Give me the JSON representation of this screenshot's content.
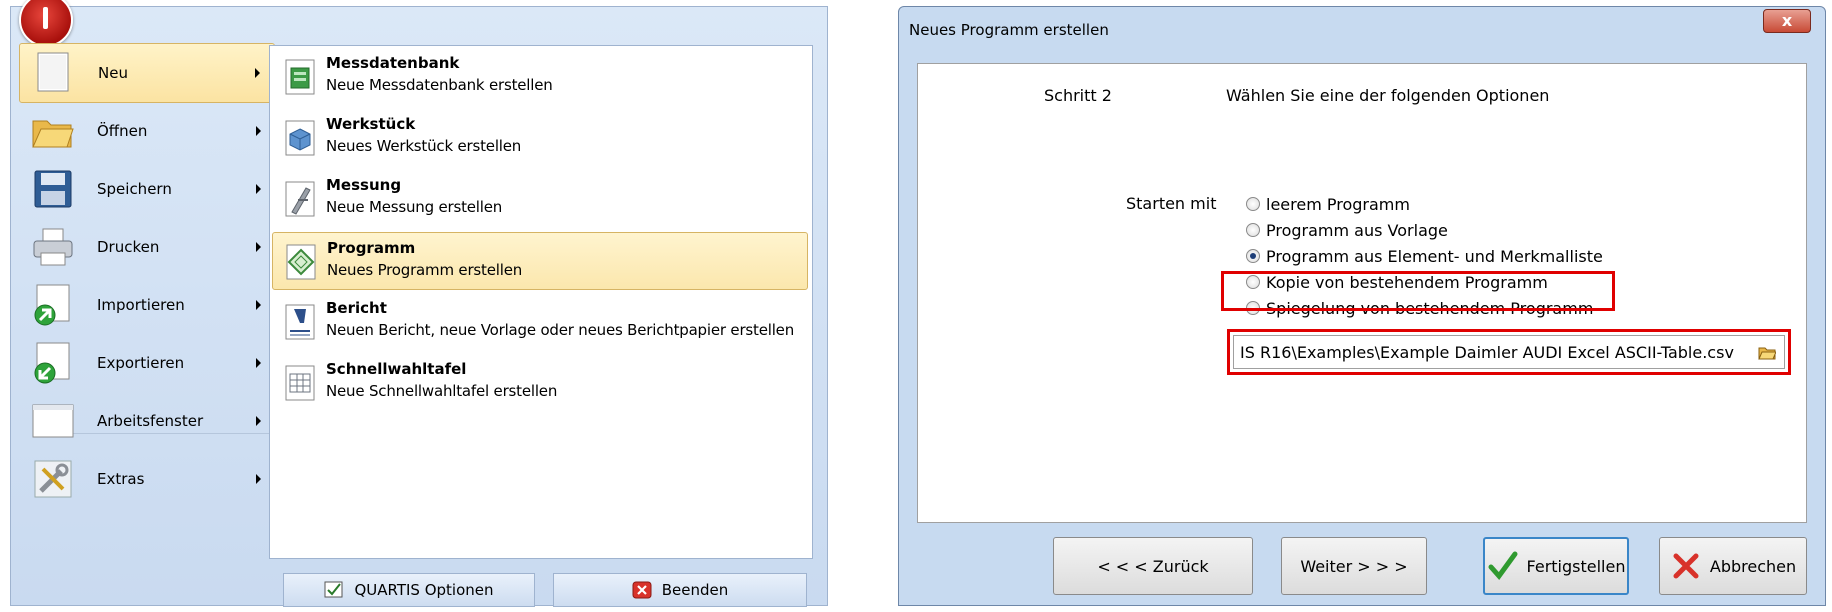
{
  "left_menu": {
    "items": [
      {
        "label": "Neu",
        "icon": "new-document-icon"
      },
      {
        "label": "Öffnen",
        "icon": "folder-open-icon"
      },
      {
        "label": "Speichern",
        "icon": "floppy-disk-icon"
      },
      {
        "label": "Drucken",
        "icon": "printer-icon"
      },
      {
        "label": "Importieren",
        "icon": "import-icon"
      },
      {
        "label": "Exportieren",
        "icon": "export-icon"
      },
      {
        "label": "Arbeitsfenster",
        "icon": "window-icon"
      },
      {
        "label": "Extras",
        "icon": "tools-icon"
      }
    ],
    "selected": "Neu"
  },
  "submenu": {
    "items": [
      {
        "title": "Messdatenbank",
        "desc": "Neue Messdatenbank erstellen",
        "icon": "database-icon"
      },
      {
        "title": "Werkstück",
        "desc": "Neues Werkstück erstellen",
        "icon": "workpiece-cube-icon"
      },
      {
        "title": "Messung",
        "desc": "Neue Messung erstellen",
        "icon": "caliper-icon"
      },
      {
        "title": "Programm",
        "desc": "Neues Programm erstellen",
        "icon": "program-diamond-icon"
      },
      {
        "title": "Bericht",
        "desc": "Neuen Bericht, neue Vorlage oder neues Berichtpapier erstellen",
        "icon": "report-icon"
      },
      {
        "title": "Schnellwahltafel",
        "desc": "Neue Schnellwahltafel erstellen",
        "icon": "grid-table-icon"
      }
    ],
    "selected": "Programm"
  },
  "footer": {
    "options_label": "QUARTIS Optionen",
    "exit_label": "Beenden"
  },
  "dialog": {
    "title": "Neues Programm erstellen",
    "close_label": "x",
    "step_label": "Schritt 2",
    "instruction": "Wählen Sie eine der folgenden Optionen",
    "start_label": "Starten mit",
    "options": [
      "leerem Programm",
      "Programm aus Vorlage",
      "Programm aus Element- und Merkmalliste",
      "Kopie von bestehendem Programm",
      "Spiegelung von bestehendem Programm"
    ],
    "selected_option": 2,
    "file_path": "IS R16\\Examples\\Example Daimler AUDI Excel ASCII-Table.csv",
    "buttons": {
      "back": "< < < Zurück",
      "next": "Weiter > > >",
      "finish": "Fertigstellen",
      "cancel": "Abbrechen"
    },
    "colors": {
      "highlight": "#e00000",
      "accent": "#3a86c8"
    }
  }
}
